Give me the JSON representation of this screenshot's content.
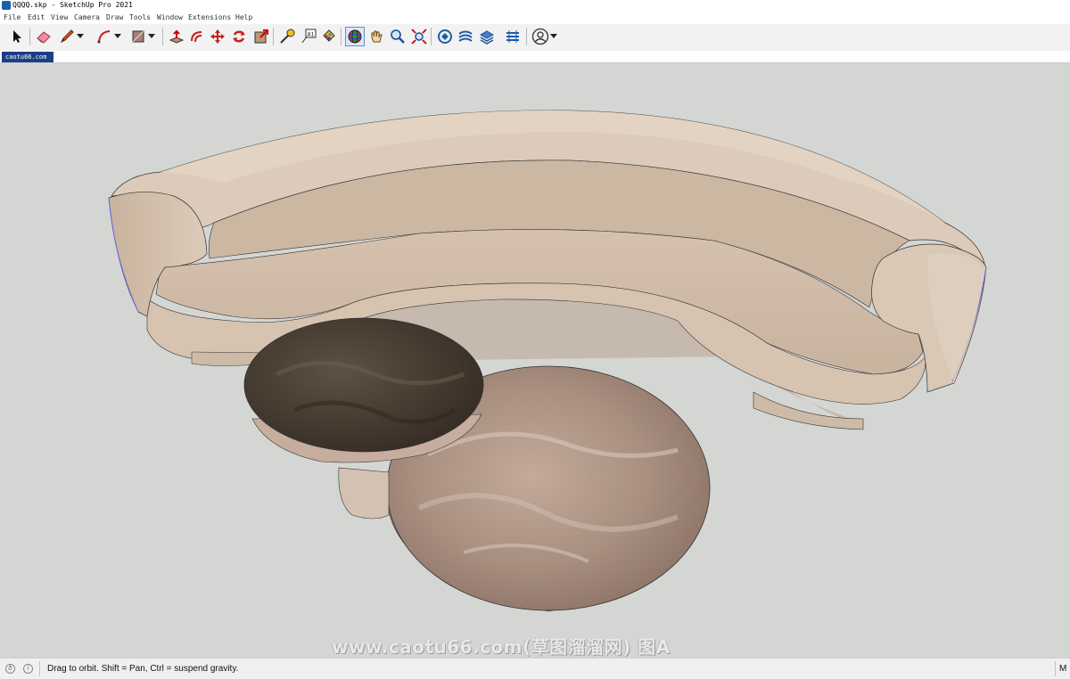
{
  "window": {
    "title": "QQQQ.skp - SketchUp Pro 2021"
  },
  "menu": [
    "File",
    "Edit",
    "View",
    "Camera",
    "Draw",
    "Tools",
    "Window",
    "Extensions",
    "Help"
  ],
  "toolbar": {
    "tools": [
      {
        "name": "select-tool",
        "icon": "cursor-arrow-icon"
      },
      {
        "name": "eraser-tool",
        "icon": "eraser-icon"
      },
      {
        "name": "line-tool",
        "icon": "pencil-icon",
        "dropdown": true
      },
      {
        "name": "arc-tool",
        "icon": "arc-icon",
        "dropdown": true
      },
      {
        "name": "shapes-tool",
        "icon": "rectangle-icon",
        "dropdown": true
      },
      {
        "name": "push-pull-tool",
        "icon": "push-pull-icon"
      },
      {
        "name": "offset-tool",
        "icon": "offset-icon"
      },
      {
        "name": "move-tool",
        "icon": "move-icon"
      },
      {
        "name": "rotate-tool",
        "icon": "rotate-icon"
      },
      {
        "name": "scale-tool",
        "icon": "scale-icon"
      },
      {
        "name": "tape-measure-tool",
        "icon": "tape-measure-icon"
      },
      {
        "name": "text-tool",
        "icon": "text-icon"
      },
      {
        "name": "paint-bucket-tool",
        "icon": "paint-bucket-icon"
      },
      {
        "name": "orbit-tool",
        "icon": "orbit-icon",
        "active": true
      },
      {
        "name": "pan-tool",
        "icon": "hand-icon"
      },
      {
        "name": "zoom-tool",
        "icon": "zoom-icon"
      },
      {
        "name": "zoom-extents-tool",
        "icon": "zoom-extents-icon"
      },
      {
        "name": "warehouse-tool",
        "icon": "3d-warehouse-icon"
      },
      {
        "name": "extension-warehouse-tool",
        "icon": "extension-warehouse-icon"
      },
      {
        "name": "send-to-layout-tool",
        "icon": "layout-icon"
      },
      {
        "name": "extension-manager-tool",
        "icon": "extension-manager-icon"
      },
      {
        "name": "account-tool",
        "icon": "user-icon",
        "dropdown": true
      }
    ]
  },
  "scene_tab": "caotu66.com",
  "watermark": "www.caotu66.com(草图溜溜网) 图A",
  "status": {
    "hint": "Drag to orbit. Shift = Pan, Ctrl = suspend gravity.",
    "measurements_label": "M"
  },
  "colors": {
    "viewport_bg": "#d4d6d3",
    "fabric": "#d8c6b4",
    "dark_marble": "#4e4335",
    "light_marble": "#a58a7c",
    "active_tool": "#dce8f7",
    "scene_tab": "#1b3f87"
  }
}
